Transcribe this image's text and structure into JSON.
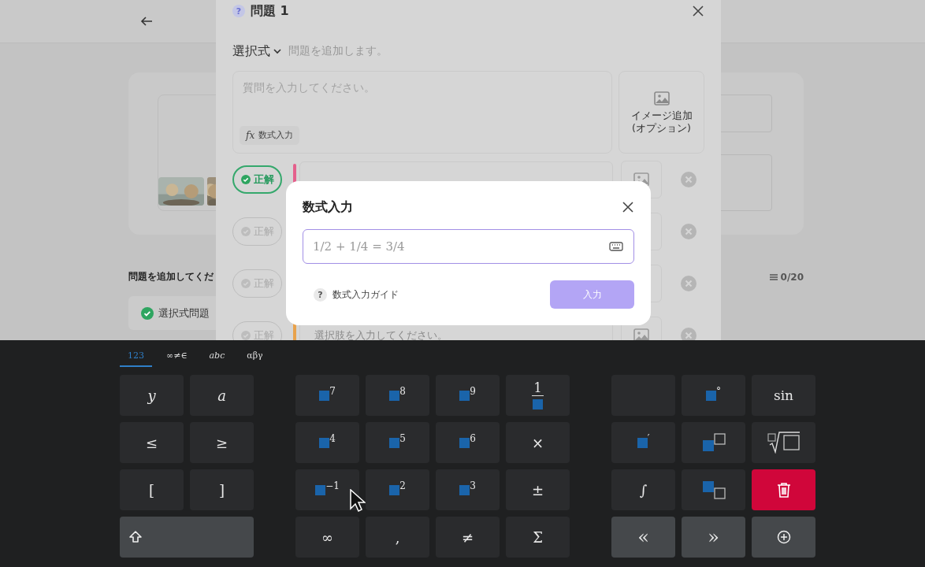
{
  "page": {
    "section_title": "問題を追加してくだ",
    "count": "0/20",
    "chip": "選択式問題"
  },
  "dialog": {
    "title_icon": "?",
    "title": "問題 1",
    "type": "選択式",
    "hint": "問題を追加します。",
    "question_placeholder": "質問を入力してください。",
    "formula_icon": "fx",
    "formula_button": "数式入力",
    "image_add": [
      "イメージ追加",
      "(オプション)"
    ],
    "options": [
      {
        "label": "正解",
        "selected": true,
        "color": "#e4608c"
      },
      {
        "label": "正解",
        "selected": false
      },
      {
        "label": "正解",
        "selected": false
      },
      {
        "label": "正解",
        "selected": false,
        "color": "#e8a24c",
        "placeholder": "選択肢を入力してください。"
      }
    ]
  },
  "formula": {
    "title": "数式入力",
    "placeholder": "1/2 + 1/4 = 3/4",
    "guide_icon": "?",
    "guide": "数式入力ガイド",
    "submit": "入力",
    "submit_disabled": true
  },
  "keyboard": {
    "tabs": [
      {
        "label": "123",
        "selected": true
      },
      {
        "label": "∞≠∈",
        "selected": false
      },
      {
        "label": "abc",
        "selected": false
      },
      {
        "label": "αβγ",
        "selected": false
      }
    ],
    "blocks": [
      [
        {
          "kind": "var",
          "label": "y"
        },
        {
          "kind": "var",
          "label": "a"
        },
        {
          "kind": "symbol",
          "label": "≤"
        },
        {
          "kind": "symbol",
          "label": "≥"
        },
        {
          "kind": "symbol",
          "label": "["
        },
        {
          "kind": "symbol",
          "label": "]"
        },
        {
          "kind": "shift"
        }
      ],
      [
        {
          "kind": "power",
          "label": "7"
        },
        {
          "kind": "power",
          "label": "8"
        },
        {
          "kind": "power",
          "label": "9"
        },
        {
          "kind": "fraction",
          "label": "1"
        },
        {
          "kind": "power",
          "label": "4"
        },
        {
          "kind": "power",
          "label": "5"
        },
        {
          "kind": "power",
          "label": "6"
        },
        {
          "kind": "symbol",
          "label": "×"
        },
        {
          "kind": "power",
          "label": "−1"
        },
        {
          "kind": "power",
          "label": "2"
        },
        {
          "kind": "power",
          "label": "3"
        },
        {
          "kind": "symbol",
          "label": "±"
        },
        {
          "kind": "symbol",
          "label": "∞"
        },
        {
          "kind": "symbol",
          "label": ","
        },
        {
          "kind": "symbol",
          "label": "≠"
        },
        {
          "kind": "symbol",
          "label": "Σ"
        }
      ],
      [
        {
          "kind": "blank"
        },
        {
          "kind": "power",
          "label": "°"
        },
        {
          "kind": "func",
          "label": "sin"
        },
        {
          "kind": "power",
          "label": "′"
        },
        {
          "kind": "power-box"
        },
        {
          "kind": "root"
        },
        {
          "kind": "var",
          "label": "∫"
        },
        {
          "kind": "sub-box"
        },
        {
          "kind": "delete"
        },
        {
          "kind": "nav",
          "label": "«"
        },
        {
          "kind": "nav",
          "label": "»"
        },
        {
          "kind": "add"
        }
      ]
    ]
  }
}
